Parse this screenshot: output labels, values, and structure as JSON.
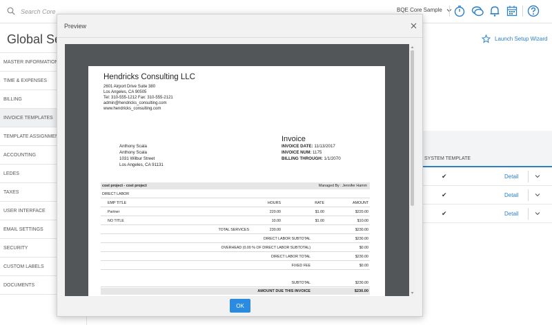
{
  "topbar": {
    "search_placeholder": "Search Core",
    "company": "BQE Core Sample",
    "icons": [
      "timer-icon",
      "chat-icon",
      "bell-icon",
      "calendar-icon",
      "help-icon"
    ]
  },
  "page": {
    "title": "Global Setup",
    "launch_wizard": "Launch Setup Wizard"
  },
  "sidebar": {
    "items": [
      {
        "label": "MASTER INFORMATION"
      },
      {
        "label": "TIME & EXPENSES"
      },
      {
        "label": "BILLING"
      },
      {
        "label": "INVOICE TEMPLATES",
        "active": true
      },
      {
        "label": "TEMPLATE ASSIGNMENT"
      },
      {
        "label": "ACCOUNTING"
      },
      {
        "label": "LEDES"
      },
      {
        "label": "TAXES"
      },
      {
        "label": "USER INTERFACE"
      },
      {
        "label": "EMAIL SETTINGS"
      },
      {
        "label": "SECURITY"
      },
      {
        "label": "CUSTOM LABELS"
      },
      {
        "label": "DOCUMENTS"
      }
    ]
  },
  "templates_table": {
    "header": "SYSTEM TEMPLATE",
    "rows": [
      {
        "system": "✔",
        "action": "Detail"
      },
      {
        "system": "✔",
        "action": "Detail"
      },
      {
        "system": "✔",
        "action": "Detail"
      }
    ]
  },
  "modal": {
    "title": "Preview",
    "ok_label": "OK"
  },
  "invoice": {
    "company_name": "Hendricks Consulting LLC",
    "address": [
      "2601 Airport Drive Suite 380",
      "Los Angeles, CA 90505",
      "Tel: 310-555-1212 Fax: 310-555-2121",
      "admin@hendricks_consulting.com",
      "www.hendricks_consulting.com"
    ],
    "title": "Invoice",
    "meta": [
      {
        "label": "INVOICE DATE:",
        "value": "11/13/2017"
      },
      {
        "label": "INVOICE NUM:",
        "value": "1175"
      },
      {
        "label": "BILLING THROUGH:",
        "value": "1/1/2070"
      }
    ],
    "bill_to": [
      "Anthony  Scala",
      "Anthony Scala",
      "1031 Wilbur Street",
      "Los Angeles, CA 91131"
    ],
    "project": "cost project - cost project",
    "managed_by": "Managed By : Jennifer Hamm",
    "section": "DIRECT LABOR",
    "columns": {
      "emp": "EMP TITLE",
      "hours": "HOURS",
      "rate": "RATE",
      "amount": "AMOUNT"
    },
    "lines": [
      {
        "title": "Partner",
        "hours": "220.00",
        "rate": "$1.00",
        "amount": "$220.00"
      },
      {
        "title": "NO TITLE",
        "hours": "10.00",
        "rate": "$1.00",
        "amount": "$10.00"
      }
    ],
    "total_services": {
      "label": "TOTAL SERVICES",
      "hours": "230.00",
      "amount": "$230.00"
    },
    "summary": [
      {
        "label": "DIRECT LABOR SUBTOTAL",
        "amount": "$230.00"
      },
      {
        "label": "OVERHEAD (0.00 % OF DIRECT LABOR SUBTOTAL)",
        "amount": "$0.00"
      },
      {
        "label": "DIRECT LABOR TOTAL",
        "amount": "$230.00"
      },
      {
        "label": "FIXED FEE",
        "amount": "$0.00"
      }
    ],
    "subtotal": {
      "label": "SUBTOTAL",
      "amount": "$230.00"
    },
    "amount_due": {
      "label": "AMOUNT DUE THIS INVOICE",
      "amount": "$230.00"
    }
  }
}
